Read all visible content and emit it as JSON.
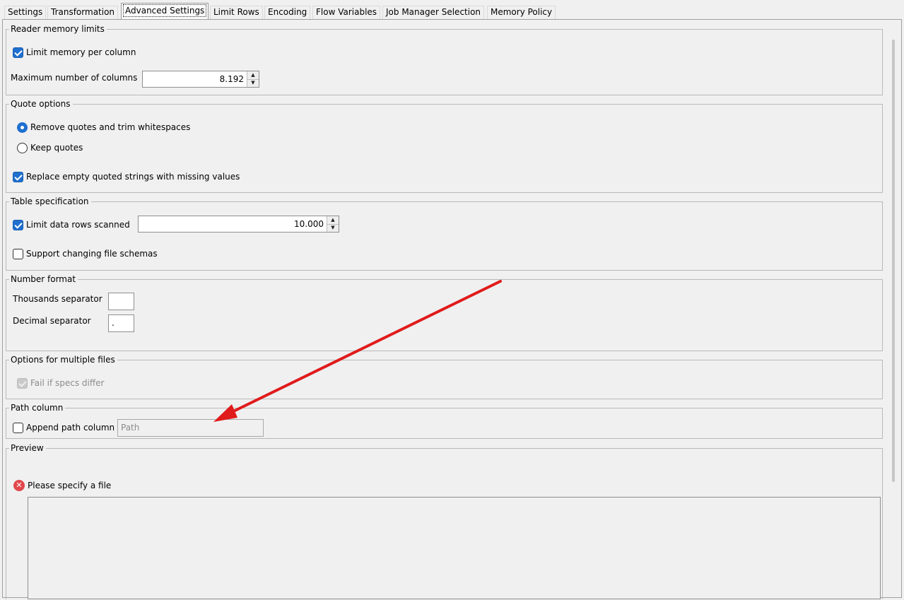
{
  "tabs": [
    {
      "label": "Settings"
    },
    {
      "label": "Transformation"
    },
    {
      "label": "Advanced Settings",
      "active": true
    },
    {
      "label": "Limit Rows"
    },
    {
      "label": "Encoding"
    },
    {
      "label": "Flow Variables"
    },
    {
      "label": "Job Manager Selection"
    },
    {
      "label": "Memory Policy"
    }
  ],
  "reader_memory": {
    "title": "Reader memory limits",
    "limit_memory_label": "Limit memory per column",
    "limit_memory_checked": true,
    "max_columns_label": "Maximum number of columns",
    "max_columns_value": "8.192"
  },
  "quote_options": {
    "title": "Quote options",
    "radio_remove_label": "Remove quotes and trim whitespaces",
    "radio_keep_label": "Keep quotes",
    "selected": "remove",
    "replace_empty_label": "Replace empty quoted strings with missing values",
    "replace_empty_checked": true
  },
  "table_spec": {
    "title": "Table specification",
    "limit_rows_label": "Limit data rows scanned",
    "limit_rows_checked": true,
    "limit_rows_value": "10.000",
    "support_schema_label": "Support changing file schemas",
    "support_schema_checked": false
  },
  "number_format": {
    "title": "Number format",
    "thousands_label": "Thousands separator",
    "thousands_value": "",
    "decimal_label": "Decimal separator",
    "decimal_value": "."
  },
  "multiple_files": {
    "title": "Options for multiple files",
    "fail_label": "Fail if specs differ",
    "fail_checked": true,
    "fail_disabled": true
  },
  "path_column": {
    "title": "Path column",
    "append_label": "Append path column",
    "append_checked": false,
    "path_placeholder": "Path"
  },
  "preview": {
    "title": "Preview",
    "error_message": "Please specify a file"
  },
  "colors": {
    "accent": "#1f6fcf",
    "error": "#e0474c",
    "annotation_arrow": "#e01b1b"
  },
  "icons": {
    "error": "error-circle-icon",
    "spinner_up": "caret-up-icon",
    "spinner_down": "caret-down-icon"
  }
}
